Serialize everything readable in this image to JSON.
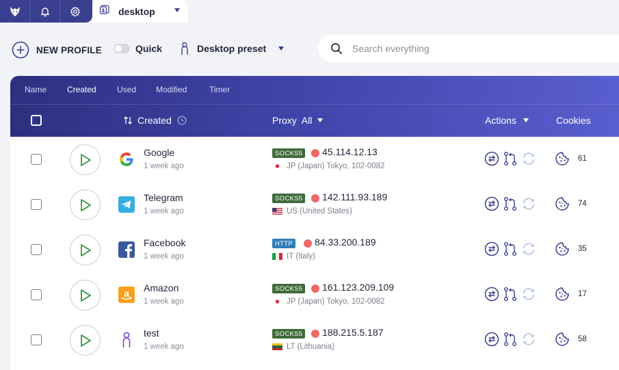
{
  "topbar": {
    "icons": [
      "wolf-logo-icon",
      "bell-icon",
      "gear-icon",
      "profile-tab-icon"
    ],
    "tab_label": "desktop"
  },
  "toolbar": {
    "new_profile_label": "NEW PROFILE",
    "quick_label": "Quick",
    "quick_enabled": false,
    "preset_label": "Desktop preset",
    "search_placeholder": "Search everything"
  },
  "colors": {
    "sidebar_dark": "#3b3f8f",
    "header_gradient_start": "#2d3080",
    "header_gradient_end": "#5a5fd0",
    "proxy_status_red": "#ef6767",
    "socks_badge": "#3f6b3a",
    "http_badge": "#2f7fb8",
    "play_green": "#2e9a45"
  },
  "sort_tabs": [
    "Name",
    "Created",
    "Used",
    "Modified",
    "Timer"
  ],
  "active_sort_tab": "Created",
  "columns": {
    "created": "Created",
    "proxy": "Proxy",
    "proxy_filter": "All",
    "actions": "Actions",
    "cookies": "Cookies"
  },
  "rows": [
    {
      "name": "Google",
      "created": "1 week ago",
      "logo": "google-logo",
      "proxy_type": "SOCKS5",
      "ip": "45.114.12.13",
      "location": "JP (Japan) Tokyo, 102-0082",
      "flag": "jp",
      "cookies": "61"
    },
    {
      "name": "Telegram",
      "created": "1 week ago",
      "logo": "telegram-logo",
      "proxy_type": "SOCKS5",
      "ip": "142.111.93.189",
      "location": "US (United States)",
      "flag": "us",
      "cookies": "74"
    },
    {
      "name": "Facebook",
      "created": "1 week ago",
      "logo": "facebook-logo",
      "proxy_type": "HTTP",
      "ip": "84.33.200.189",
      "location": "IT (Italy)",
      "flag": "it",
      "cookies": "35"
    },
    {
      "name": "Amazon",
      "created": "1 week ago",
      "logo": "amazon-logo",
      "proxy_type": "SOCKS5",
      "ip": "161.123.209.109",
      "location": "JP (Japan) Tokyo, 102-0082",
      "flag": "jp",
      "cookies": "17"
    },
    {
      "name": "test",
      "created": "1 week ago",
      "logo": "person-logo",
      "proxy_type": "SOCKS5",
      "ip": "188.215.5.187",
      "location": "LT (Lithuania)",
      "flag": "lt",
      "cookies": "58"
    }
  ]
}
